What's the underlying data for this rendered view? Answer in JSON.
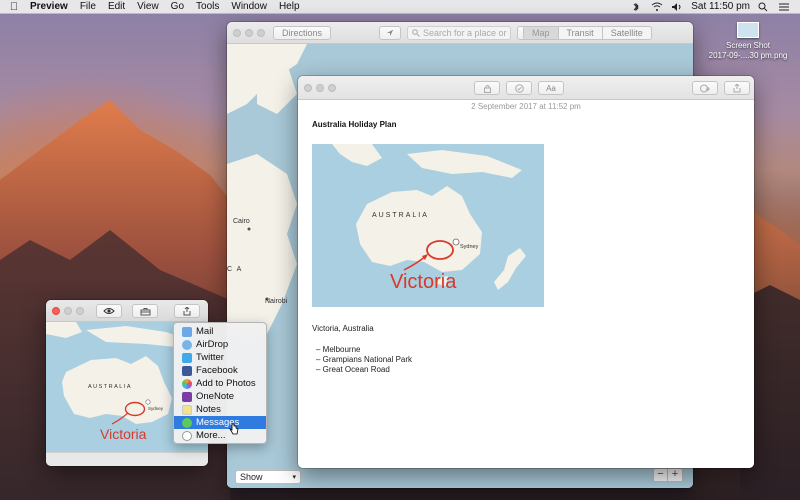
{
  "menubar": {
    "app": "Preview",
    "items": [
      "File",
      "Edit",
      "View",
      "Go",
      "Tools",
      "Window",
      "Help"
    ],
    "clock": "Sat 11:50 pm"
  },
  "desktop": {
    "file_label_1": "Screen Shot",
    "file_label_2": "2017-09-....30 pm.png"
  },
  "maps": {
    "directions": "Directions",
    "search_placeholder": "Search for a place or",
    "view_tabs": [
      "Map",
      "Transit",
      "Satellite"
    ],
    "show_label": "Show",
    "zoom_minus": "−",
    "zoom_plus": "+",
    "labels": {
      "cairo": "Cairo",
      "nairobi": "Nairobi",
      "africa_fragment": "C A"
    }
  },
  "notes": {
    "date": "2 September 2017 at 11:52 pm",
    "title": "Australia Holiday Plan",
    "map_country": "AUSTRALIA",
    "map_city": "Sydney",
    "map_annotation": "Victoria",
    "subtitle": "Victoria, Australia",
    "list": [
      "Melbourne",
      "Grampians National Park",
      "Great Ocean Road"
    ]
  },
  "preview": {
    "map_country": "AUSTRALIA",
    "map_city": "Sydney",
    "map_annotation": "Victoria"
  },
  "share_menu": {
    "items": [
      {
        "label": "Mail",
        "icon": "mail-icon",
        "color": "#6aa8e8"
      },
      {
        "label": "AirDrop",
        "icon": "airdrop-icon",
        "color": "#7ab3e6"
      },
      {
        "label": "Twitter",
        "icon": "twitter-icon",
        "color": "#41a9ea"
      },
      {
        "label": "Facebook",
        "icon": "facebook-icon",
        "color": "#3b5998"
      },
      {
        "label": "Add to Photos",
        "icon": "photos-icon",
        "color": "#f0a030"
      },
      {
        "label": "OneNote",
        "icon": "onenote-icon",
        "color": "#7b3da3"
      },
      {
        "label": "Notes",
        "icon": "notes-icon",
        "color": "#f3e28b"
      },
      {
        "label": "Messages",
        "icon": "messages-icon",
        "color": "#5cc95a"
      },
      {
        "label": "More...",
        "icon": "more-icon",
        "color": "#cfcfcf"
      }
    ],
    "selected": "Messages"
  },
  "colors": {
    "accent": "#2f7be0",
    "annotation": "#d9392b",
    "land": "#f3f1e8",
    "water": "#a9cfe0"
  }
}
